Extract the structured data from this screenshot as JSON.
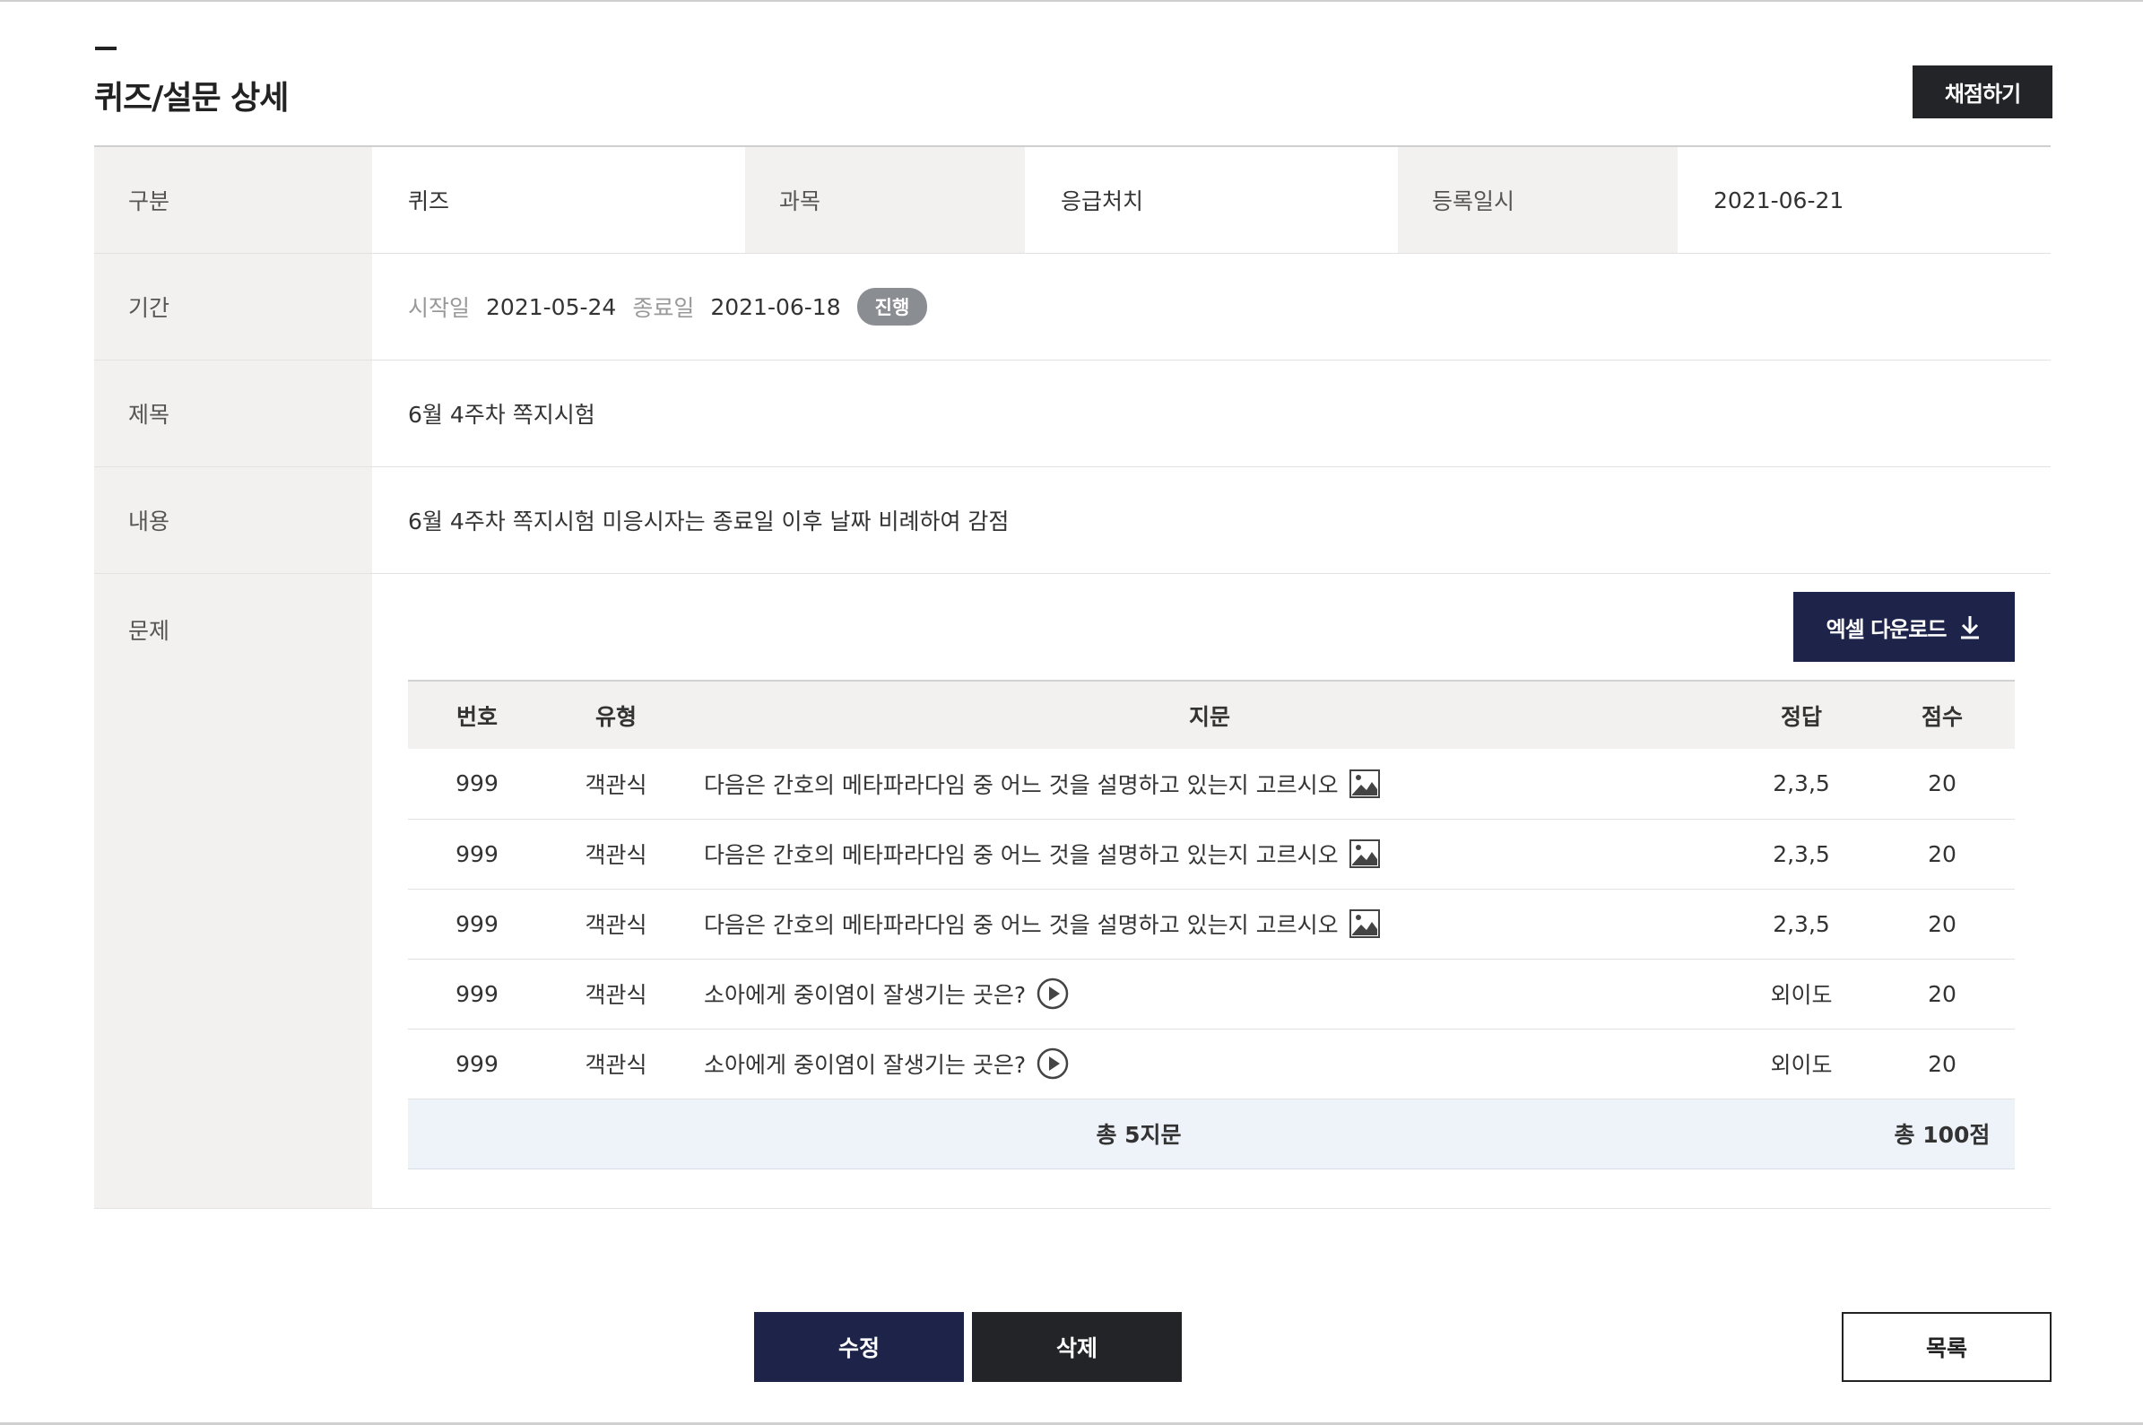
{
  "page": {
    "title": "퀴즈/설문 상세",
    "grade_button": "채점하기"
  },
  "info": {
    "category_label": "구분",
    "category_value": "퀴즈",
    "subject_label": "과목",
    "subject_value": "응급처치",
    "registered_label": "등록일시",
    "registered_value": "2021-06-21",
    "period_label": "기간",
    "start_label": "시작일",
    "start_value": "2021-05-24",
    "end_label": "종료일",
    "end_value": "2021-06-18",
    "status": "진행",
    "title_label": "제목",
    "title_value": "6월 4주차 쪽지시험",
    "content_label": "내용",
    "content_value": "6월 4주차 쪽지시험 미응시자는 종료일 이후 날짜 비례하여 감점",
    "questions_label": "문제"
  },
  "excel_button": "엑셀 다운로드",
  "questions": {
    "headers": {
      "no": "번호",
      "type": "유형",
      "question": "지문",
      "answer": "정답",
      "score": "점수"
    },
    "rows": [
      {
        "no": "999",
        "type": "객관식",
        "question": "다음은 간호의 메타파라다임 중 어느 것을 설명하고 있는지 고르시오",
        "media": "image-icon",
        "answer": "2,3,5",
        "score": "20"
      },
      {
        "no": "999",
        "type": "객관식",
        "question": "다음은 간호의 메타파라다임 중 어느 것을 설명하고 있는지 고르시오",
        "media": "image-icon",
        "answer": "2,3,5",
        "score": "20"
      },
      {
        "no": "999",
        "type": "객관식",
        "question": "다음은 간호의 메타파라다임 중 어느 것을 설명하고 있는지 고르시오",
        "media": "image-icon",
        "answer": "2,3,5",
        "score": "20"
      },
      {
        "no": "999",
        "type": "객관식",
        "question": "소아에게 중이염이 잘생기는 곳은?",
        "media": "play-icon",
        "answer": "외이도",
        "score": "20"
      },
      {
        "no": "999",
        "type": "객관식",
        "question": "소아에게 중이염이 잘생기는 곳은?",
        "media": "play-icon",
        "answer": "외이도",
        "score": "20"
      }
    ],
    "total_count": "총 5지문",
    "total_score": "총 100점"
  },
  "buttons": {
    "edit": "수정",
    "delete": "삭제",
    "list": "목록"
  },
  "colors": {
    "navy": "#1e2349",
    "dark": "#222428",
    "header_bg": "#f2f1ef",
    "total_bg": "#eef2f9",
    "badge": "#8a8d92"
  }
}
